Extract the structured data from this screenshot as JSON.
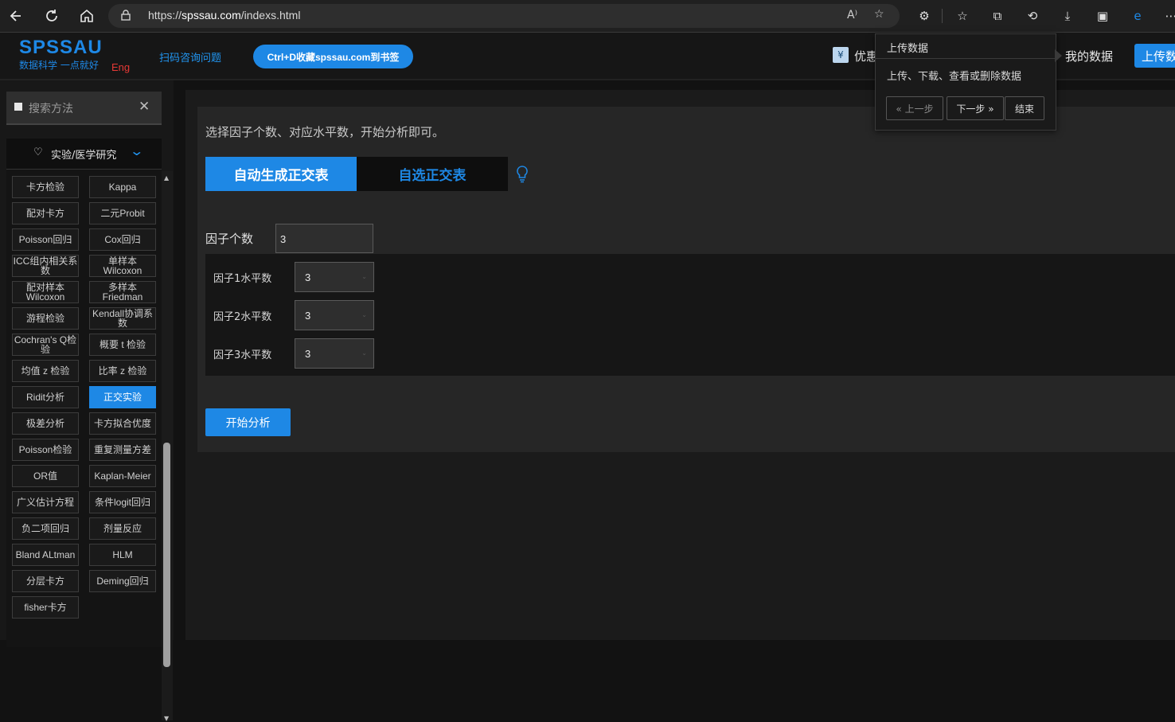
{
  "browser": {
    "url_scheme": "https://",
    "url_host": "spssau.com",
    "url_path": "/indexs.html",
    "read_aloud_label": "A⁾"
  },
  "header": {
    "logo": "SPSSAU",
    "slogan": "数据科学 一点就好",
    "lang": "Eng",
    "scan_link": "扫码咨询问题",
    "bookmark_button": "Ctrl+D收藏spssau.com到书签",
    "promo_text": "优惠",
    "my_data": "我的数据",
    "upload_data": "上传数"
  },
  "sidebar": {
    "search_placeholder": "搜索方法",
    "category_label": "实验/医学研究",
    "methods": [
      {
        "label": "卡方检验",
        "active": false
      },
      {
        "label": "Kappa",
        "active": false
      },
      {
        "label": "配对卡方",
        "active": false
      },
      {
        "label": "二元Probit",
        "active": false
      },
      {
        "label": "Poisson回归",
        "active": false
      },
      {
        "label": "Cox回归",
        "active": false
      },
      {
        "label": "ICC组内相关系数",
        "active": false
      },
      {
        "label": "单样本Wilcoxon",
        "active": false
      },
      {
        "label": "配对样本Wilcoxon",
        "active": false
      },
      {
        "label": "多样本Friedman",
        "active": false
      },
      {
        "label": "游程检验",
        "active": false
      },
      {
        "label": "Kendall协调系数",
        "active": false
      },
      {
        "label": "Cochran's Q检验",
        "active": false
      },
      {
        "label": "概要 t 检验",
        "active": false
      },
      {
        "label": "均值 z 检验",
        "active": false
      },
      {
        "label": "比率 z 检验",
        "active": false
      },
      {
        "label": "Ridit分析",
        "active": false
      },
      {
        "label": "正交实验",
        "active": true
      },
      {
        "label": "极差分析",
        "active": false
      },
      {
        "label": "卡方拟合优度",
        "active": false
      },
      {
        "label": "Poisson检验",
        "active": false
      },
      {
        "label": "重复测量方差",
        "active": false
      },
      {
        "label": "OR值",
        "active": false
      },
      {
        "label": "Kaplan-Meier",
        "active": false
      },
      {
        "label": "广义估计方程",
        "active": false
      },
      {
        "label": "条件logit回归",
        "active": false
      },
      {
        "label": "负二项回归",
        "active": false
      },
      {
        "label": "剂量反应",
        "active": false
      },
      {
        "label": "Bland ALtman",
        "active": false
      },
      {
        "label": "HLM",
        "active": false
      },
      {
        "label": "分层卡方",
        "active": false
      },
      {
        "label": "Deming回归",
        "active": false
      },
      {
        "label": "fisher卡方",
        "active": false
      }
    ]
  },
  "main": {
    "instruction": "选择因子个数、对应水平数，开始分析即可。",
    "tab_auto": "自动生成正交表",
    "tab_manual": "自选正交表",
    "factor_count_label": "因子个数",
    "factor_count_value": "3",
    "levels": [
      {
        "label": "因子1水平数",
        "value": "3"
      },
      {
        "label": "因子2水平数",
        "value": "3"
      },
      {
        "label": "因子3水平数",
        "value": "3"
      }
    ],
    "start_button": "开始分析"
  },
  "tour": {
    "title": "上传数据",
    "body": "上传、下载、查看或删除数据",
    "prev": "« 上一步",
    "next": "下一步 »",
    "end": "结束"
  },
  "colors": {
    "accent": "#1e88e5",
    "eng_red": "#e53935"
  }
}
